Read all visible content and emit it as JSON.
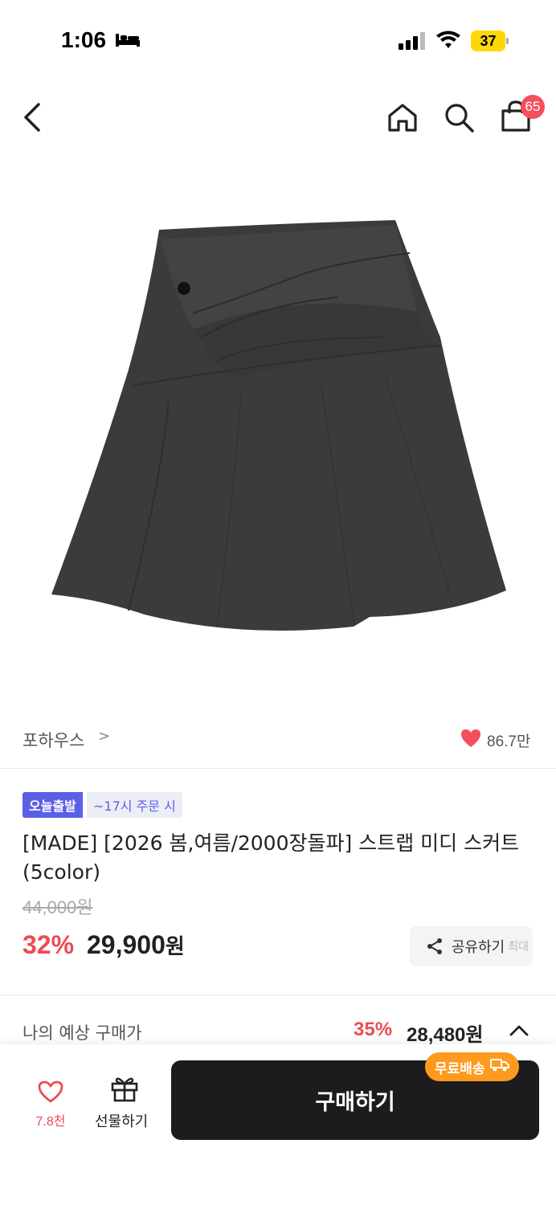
{
  "status": {
    "time": "1:06",
    "battery": "37"
  },
  "nav": {
    "cart_count": "65"
  },
  "brand": {
    "name": "포하우스",
    "chevron": ">",
    "likes": "86.7만"
  },
  "badges": {
    "today": "오늘출발",
    "time": "~17시 주문 시"
  },
  "product": {
    "title": "[MADE] [2026 봄,여름/2000장돌파] 스트랩 미디 스커트 (5color)",
    "original_price": "44,000원",
    "discount_rate": "32%",
    "sale_price": "29,900",
    "sale_unit": "원"
  },
  "share": {
    "label": "공유하기",
    "extra": "최대"
  },
  "estimate": {
    "label": "나의 예상 구매가",
    "rate": "35%",
    "price": "28,480원"
  },
  "bottom": {
    "wish_count": "7.8천",
    "gift_label": "선물하기",
    "buy_label": "구매하기",
    "free_shipping": "무료배송"
  },
  "colors": {
    "accent_red": "#ef4b55",
    "today_badge": "#5b5fe8",
    "free_ship": "#ff9a1f",
    "buy_button": "#1c1c1e"
  }
}
